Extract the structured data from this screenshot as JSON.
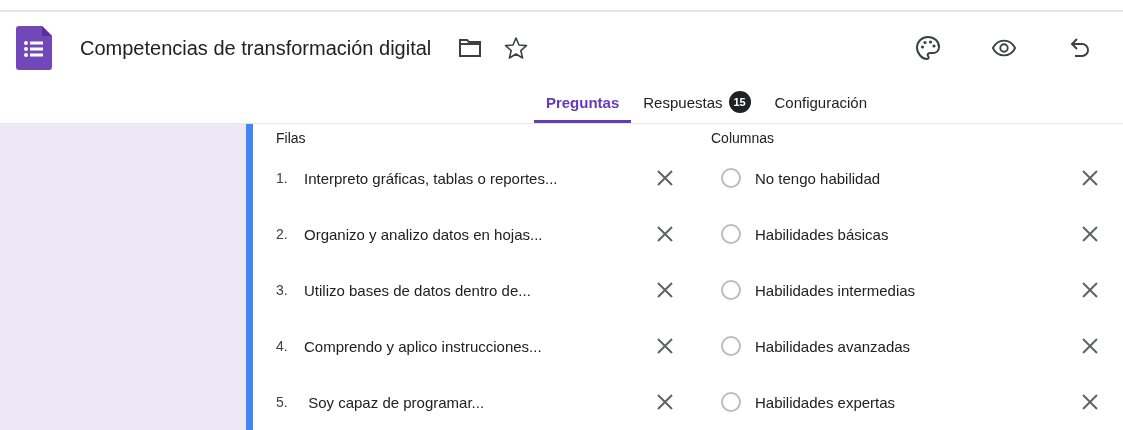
{
  "header": {
    "title": "Competencias de transformación digital"
  },
  "tabs": [
    {
      "label": "Preguntas",
      "selected": true
    },
    {
      "label": "Respuestas",
      "selected": false,
      "badge": "15"
    },
    {
      "label": "Configuración",
      "selected": false
    }
  ],
  "grid_question": {
    "rows_heading": "Filas",
    "columns_heading": "Columnas",
    "rows": [
      {
        "number": "1.",
        "text": "Interpreto gráficas, tablas o reportes..."
      },
      {
        "number": "2.",
        "text": "Organizo y analizo datos en hojas..."
      },
      {
        "number": "3.",
        "text": "Utilizo bases de datos dentro de..."
      },
      {
        "number": "4.",
        "text": "Comprendo y aplico instrucciones..."
      },
      {
        "number": "5.",
        "text": " Soy capaz de programar..."
      }
    ],
    "columns": [
      {
        "text": "No tengo habilidad",
        "selected": false
      },
      {
        "text": "Habilidades básicas",
        "selected": false
      },
      {
        "text": "Habilidades intermedias",
        "selected": false
      },
      {
        "text": "Habilidades avanzadas",
        "selected": false
      },
      {
        "text": "Habilidades expertas",
        "selected": false
      }
    ]
  }
}
